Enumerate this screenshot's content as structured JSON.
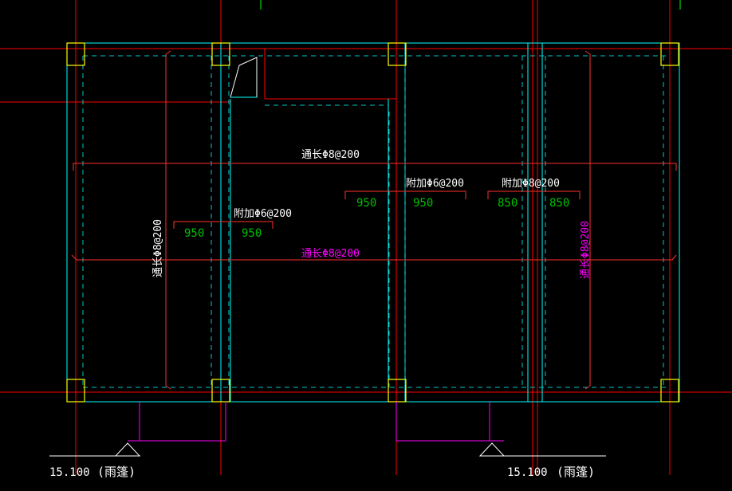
{
  "colors": {
    "background": "#000000",
    "axis": "#ff0000",
    "beam": "#00ffff",
    "beam_hidden": "#00c8c8",
    "column": "#ffff00",
    "rebar_white": "#ffffff",
    "rebar_magenta": "#ff00ff",
    "dim_green": "#00c000",
    "dim_line": "#ff3030",
    "grid_green": "#00ff00"
  },
  "annotations": {
    "top_through": "通长Φ8@200",
    "mid_through": "通长Φ8@200",
    "left_vertical": "通长Φ8@200",
    "right_vertical": "通长Φ8@200",
    "add_left": "附加Φ6@200",
    "add_center": "附加Φ6@200",
    "add_right": "附加Φ8@200"
  },
  "dimensions": {
    "left_a": "950",
    "left_b": "950",
    "center_a": "950",
    "center_b": "950",
    "right_a": "850",
    "right_b": "850"
  },
  "elevations": {
    "left_value": "15.100",
    "left_note": "(雨篷)",
    "right_value": "15.100",
    "right_note": "(雨篷)"
  }
}
